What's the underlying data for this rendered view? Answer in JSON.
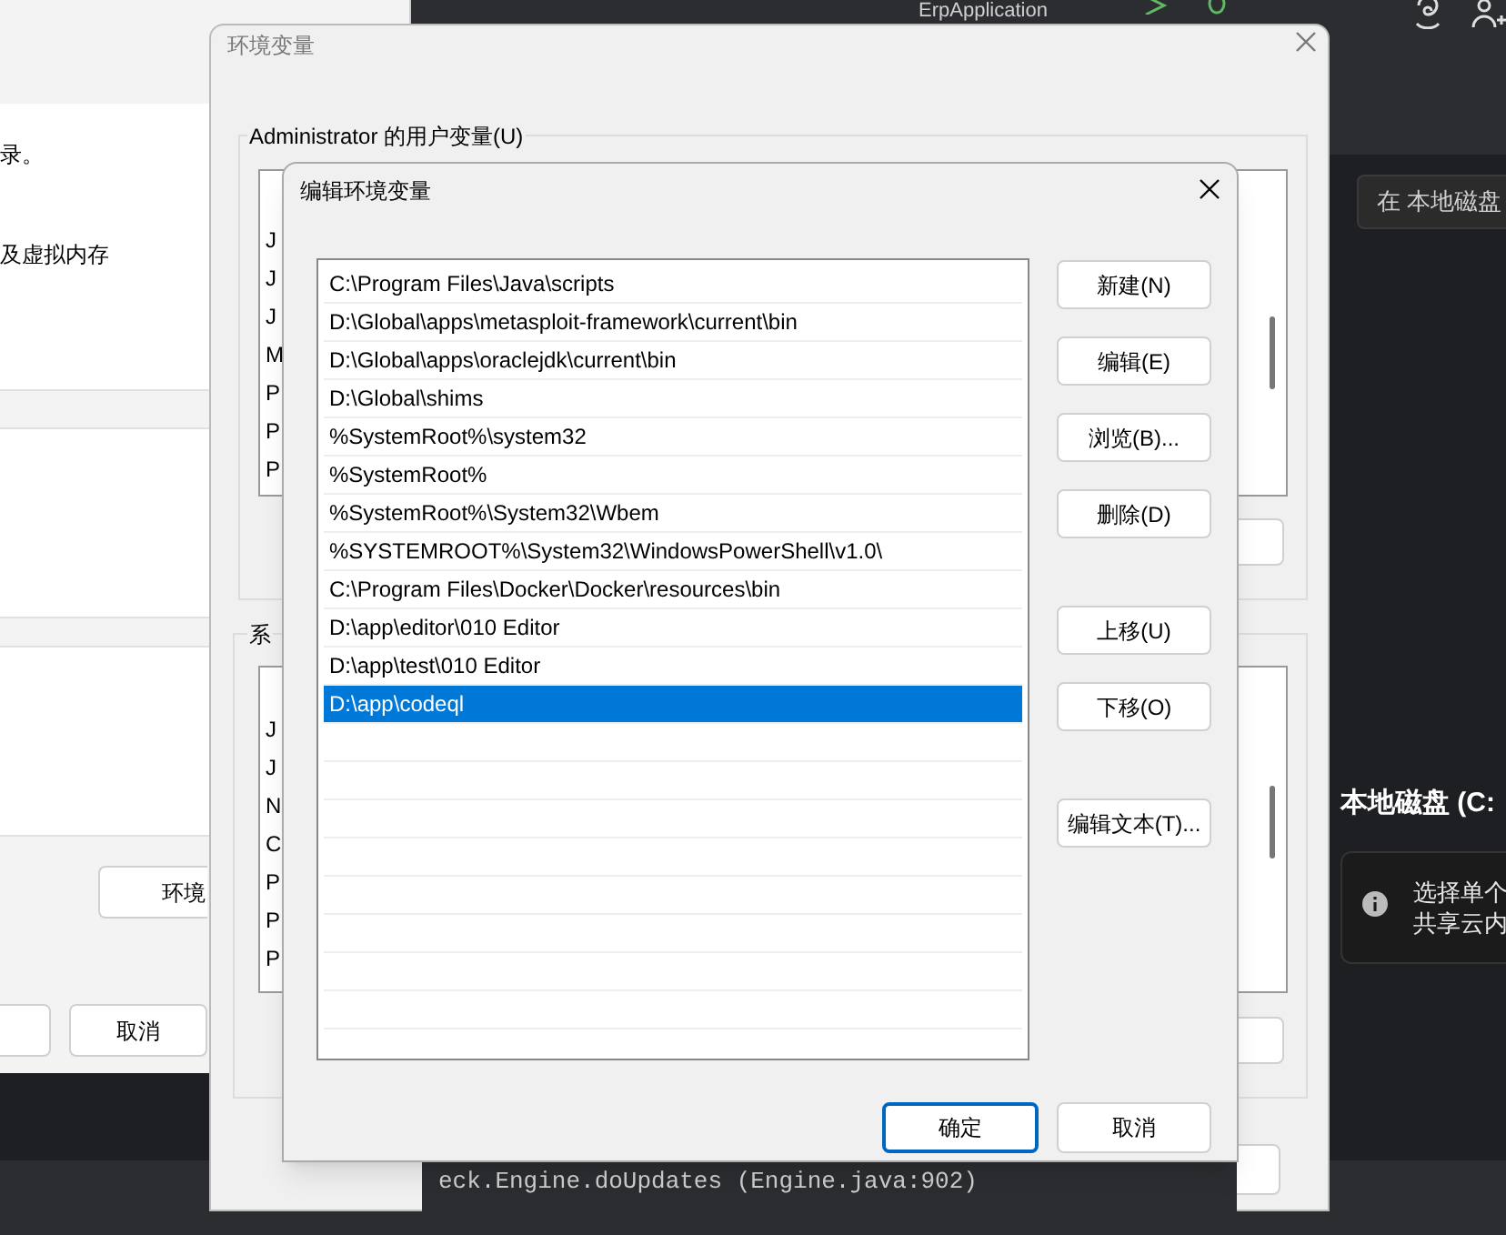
{
  "ide": {
    "run_config": "ErpApplication",
    "search_placeholder": "在 本地磁盘",
    "drive_title": "本地磁盘 (C:",
    "info_lines": [
      "选择单个",
      "共享云内"
    ],
    "code_line": "eck.Engine.doUpdates (Engine.java:902)"
  },
  "system_properties": {
    "texts": [
      "录。",
      "及虚拟内存"
    ],
    "env_button": "环境",
    "cancel": "取消"
  },
  "env_window": {
    "title": "环境变量",
    "user_group": "Administrator 的用户变量(U)",
    "user_rows": [
      "J",
      "J",
      "J",
      "M",
      "P",
      "P",
      "P"
    ],
    "system_group": "系",
    "system_rows": [
      "J",
      "J",
      "N",
      "C",
      "P",
      "P",
      "P"
    ]
  },
  "edit_dialog": {
    "title": "编辑环境变量",
    "paths": [
      {
        "text": "C:\\Program Files\\Java\\scripts",
        "selected": false
      },
      {
        "text": "D:\\Global\\apps\\metasploit-framework\\current\\bin",
        "selected": false
      },
      {
        "text": "D:\\Global\\apps\\oraclejdk\\current\\bin",
        "selected": false
      },
      {
        "text": "D:\\Global\\shims",
        "selected": false
      },
      {
        "text": "%SystemRoot%\\system32",
        "selected": false
      },
      {
        "text": "%SystemRoot%",
        "selected": false
      },
      {
        "text": "%SystemRoot%\\System32\\Wbem",
        "selected": false
      },
      {
        "text": "%SYSTEMROOT%\\System32\\WindowsPowerShell\\v1.0\\",
        "selected": false
      },
      {
        "text": "C:\\Program Files\\Docker\\Docker\\resources\\bin",
        "selected": false
      },
      {
        "text": "D:\\app\\editor\\010 Editor",
        "selected": false
      },
      {
        "text": "D:\\app\\test\\010 Editor",
        "selected": false
      },
      {
        "text": "D:\\app\\codeql",
        "selected": true
      }
    ],
    "side_button_groups": [
      [
        "新建(N)",
        "编辑(E)",
        "浏览(B)...",
        "删除(D)"
      ],
      [
        "上移(U)",
        "下移(O)"
      ],
      [
        "编辑文本(T)..."
      ]
    ],
    "ok": "确定",
    "cancel": "取消"
  }
}
